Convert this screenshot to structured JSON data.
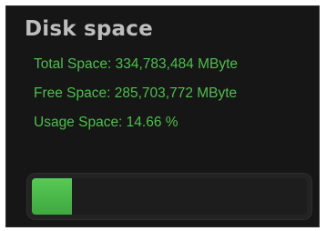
{
  "widget": {
    "title": "Disk space",
    "total_space": "Total Space: 334,783,484 MByte",
    "free_space": "Free Space: 285,703,772 MByte",
    "usage_space": "Usage Space: 14.66 %",
    "usage_fraction": 0.1466,
    "colors": {
      "accent": "#4fbe4f",
      "bar_fill": "#4cbf4c",
      "panel_bg": "#161616",
      "title": "#bdbdbd"
    }
  }
}
